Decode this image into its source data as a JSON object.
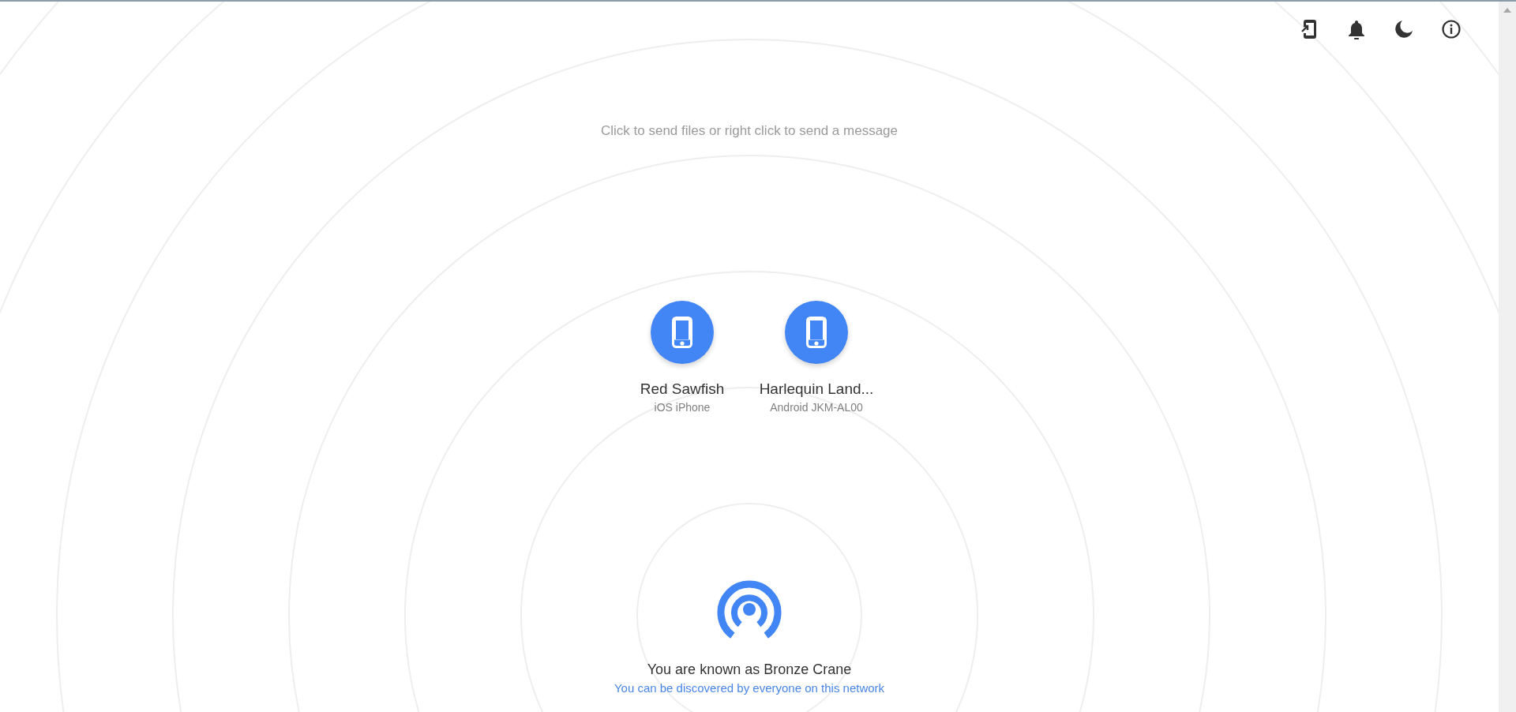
{
  "instructions": "Click to send files or right click to send a message",
  "peers": [
    {
      "name": "Red Sawfish",
      "device": "iOS iPhone"
    },
    {
      "name": "Harlequin Land...",
      "device": "Android JKM-AL00"
    }
  ],
  "footer": {
    "display_name": "You are known as Bronze Crane",
    "discovery": "You can be discovered by everyone on this network"
  }
}
